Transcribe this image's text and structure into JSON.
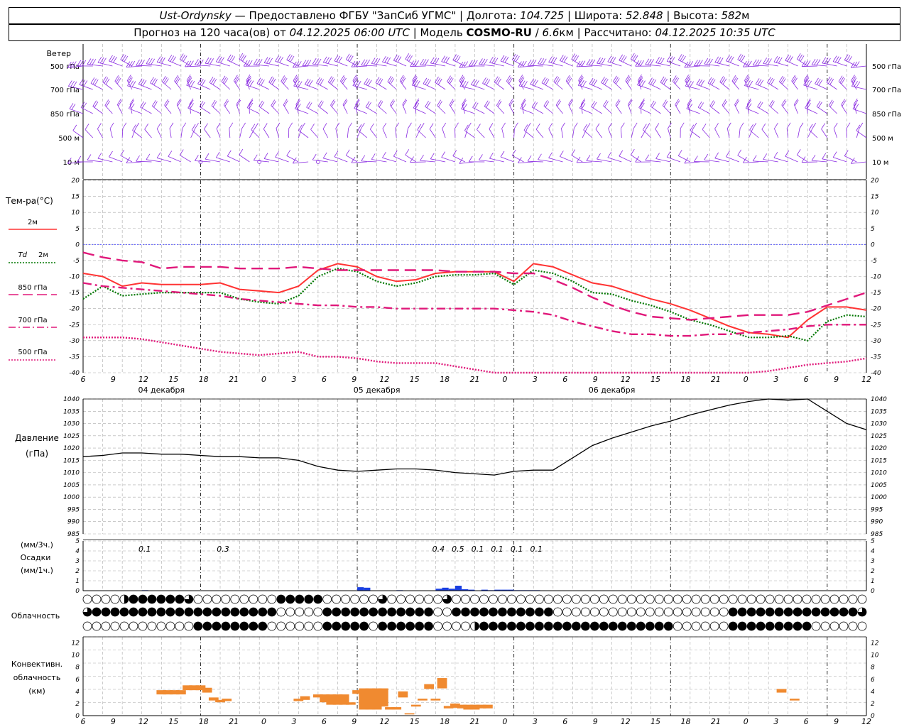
{
  "header": {
    "station": "Ust-Ordynsky",
    "line1_dash": " — ",
    "provider": "Предоставлено ФГБУ \"ЗапСиб УГМС\"",
    "lon_label": "Долгота:",
    "lon_value": "104.725",
    "lat_label": "Широта:",
    "lat_value": "52.848",
    "alt_label": "Высота:",
    "alt_value": "582",
    "alt_unit": "м",
    "forecast_prefix": "Прогноз на 120 часа(ов) от",
    "forecast_start": "04.12.2025 06:00 UTC",
    "model_label": "Модель",
    "model_name": "COSMO-RU",
    "model_res": "6.6",
    "model_res_unit": "км",
    "computed_label": "Рассчитано:",
    "computed_value": "04.12.2025 10:35 UTC"
  },
  "chart_data": [
    {
      "type": "wind_barbs",
      "title": "Ветер",
      "levels": [
        "500 гПа",
        "700 гПа",
        "850 гПа",
        "500 м",
        "10 м"
      ],
      "color": "#8a2be2"
    },
    {
      "type": "line",
      "title": "Тем-ра(°C)",
      "ylim": [
        -40,
        20
      ],
      "yticks": [
        20,
        15,
        10,
        5,
        0,
        -5,
        -10,
        -15,
        -20,
        -25,
        -30,
        -35,
        -40
      ],
      "x_hours": [
        0,
        3,
        6,
        9,
        12,
        15,
        18,
        21,
        24,
        27,
        30,
        33,
        36,
        39,
        42,
        45,
        48,
        51,
        54,
        57,
        60,
        63,
        66,
        69,
        72,
        75,
        78,
        81,
        84,
        87,
        90,
        93,
        96,
        99,
        102,
        105,
        108,
        111,
        114,
        117,
        120
      ],
      "series": [
        {
          "name": "2м",
          "color": "#ff3333",
          "style": "solid",
          "values": [
            -9,
            -10,
            -13,
            -12,
            -12.5,
            -12.5,
            -12.5,
            -12,
            -14,
            -14.5,
            -15,
            -13,
            -8,
            -6,
            -7,
            -10,
            -11.5,
            -11,
            -9,
            -8.5,
            -8.5,
            -8.5,
            -11.5,
            -6,
            -7,
            -9.5,
            -12,
            -13,
            -15,
            -17,
            -18.5,
            -20.5,
            -23,
            -25.5,
            -27.5,
            -28,
            -29,
            -23.5,
            -19.5,
            -19.5,
            -20.5
          ]
        },
        {
          "name": "Td 2м",
          "color": "#007700",
          "style": "dotted",
          "values": [
            -17,
            -13,
            -16,
            -15.5,
            -15,
            -15,
            -15,
            -15,
            -17,
            -18,
            -18.5,
            -16,
            -10,
            -7.5,
            -8.5,
            -11.5,
            -13,
            -12,
            -10,
            -9.5,
            -9.5,
            -9,
            -12.5,
            -8,
            -9,
            -11.5,
            -15,
            -15.5,
            -17.5,
            -19,
            -21,
            -23.5,
            -25,
            -27,
            -29,
            -29,
            -28.5,
            -30,
            -24,
            -22,
            -22.5
          ]
        },
        {
          "name": "850 гПа",
          "color": "#e0187a",
          "style": "dashed",
          "values": [
            -2.5,
            -4,
            -5,
            -5.5,
            -7.5,
            -7,
            -7,
            -7,
            -7.5,
            -7.5,
            -7.5,
            -7,
            -7.5,
            -8,
            -8,
            -8,
            -8,
            -8,
            -8,
            -8.5,
            -8.5,
            -8.5,
            -9,
            -9,
            -11,
            -13.5,
            -16.5,
            -19,
            -21,
            -22.5,
            -23,
            -23.5,
            -23,
            -22.5,
            -22,
            -22,
            -22,
            -21,
            -19,
            -17,
            -15
          ]
        },
        {
          "name": "700 гПа",
          "color": "#e0187a",
          "style": "dashdot",
          "values": [
            -12,
            -13,
            -13.5,
            -14,
            -14.5,
            -15,
            -15.5,
            -16,
            -17,
            -17.5,
            -18,
            -18.5,
            -19,
            -19,
            -19.5,
            -19.5,
            -20,
            -20,
            -20,
            -20,
            -20,
            -20,
            -20.5,
            -21,
            -22,
            -24,
            -25.5,
            -27,
            -28,
            -28,
            -28.5,
            -28.5,
            -28,
            -28,
            -27.5,
            -27,
            -26.5,
            -25.5,
            -25,
            -25,
            -25
          ]
        },
        {
          "name": "500 гПа",
          "color": "#e0187a",
          "style": "dotted",
          "values": [
            -29,
            -29,
            -29,
            -29.5,
            -30.5,
            -31.5,
            -32.5,
            -33.5,
            -34,
            -34.5,
            -34,
            -33.5,
            -35,
            -35,
            -35.5,
            -36.5,
            -37,
            -37,
            -37,
            -38,
            -39,
            -40.5,
            -42,
            -43,
            -43,
            -43,
            -43,
            -43,
            -43,
            -43,
            -43,
            -43,
            -42.5,
            -42,
            -41,
            -39.5,
            -38.5,
            -37.5,
            -37,
            -36.5,
            -35.5
          ]
        }
      ],
      "zero_line_color": "#4444ff"
    },
    {
      "type": "line",
      "title": "Давление",
      "unit": "(гПа)",
      "ylim": [
        985,
        1040
      ],
      "yticks": [
        1040,
        1035,
        1030,
        1025,
        1020,
        1015,
        1010,
        1005,
        1000,
        995,
        990,
        985
      ],
      "x_hours": [
        0,
        3,
        6,
        9,
        12,
        15,
        18,
        21,
        24,
        27,
        30,
        33,
        36,
        39,
        42,
        45,
        48,
        51,
        54,
        57,
        60,
        63,
        66,
        69,
        72,
        75,
        78,
        81,
        84,
        87,
        90,
        93,
        96,
        99,
        102,
        105,
        108,
        111,
        114,
        117,
        120
      ],
      "series": [
        {
          "name": "",
          "color": "#000000",
          "values": [
            1016.5,
            1017,
            1018,
            1018,
            1017.5,
            1017.5,
            1017,
            1016.5,
            1016.5,
            1016,
            1016,
            1015,
            1012.5,
            1011,
            1010.5,
            1011,
            1011.5,
            1011.5,
            1011,
            1010,
            1009.5,
            1009,
            1010.5,
            1011,
            1011,
            1016,
            1021,
            1024,
            1026.5,
            1029,
            1031,
            1033.5,
            1035.5,
            1037.5,
            1039,
            1040,
            1039.5,
            1040,
            1035,
            1030,
            1027.5
          ]
        }
      ]
    },
    {
      "type": "bar",
      "title": "Осадки",
      "unit_left": "(мм/3ч.)",
      "unit_left2": "(мм/1ч.)",
      "ylim": [
        0,
        5
      ],
      "yticks": [
        5,
        4,
        3,
        2,
        1,
        0
      ],
      "labels": [
        {
          "hour": 9,
          "text": "0.1"
        },
        {
          "hour": 21,
          "text": "0.3"
        },
        {
          "hour": 54,
          "text": "0.4"
        },
        {
          "hour": 57,
          "text": "0.5"
        },
        {
          "hour": 60,
          "text": "0.1"
        },
        {
          "hour": 63,
          "text": "0.1"
        },
        {
          "hour": 66,
          "text": "0.1"
        },
        {
          "hour": 69,
          "text": "0.1"
        }
      ],
      "bars": [
        {
          "hour": 9,
          "value": 0.05
        },
        {
          "hour": 42,
          "value": 0.35
        },
        {
          "hour": 43,
          "value": 0.3
        },
        {
          "hour": 48,
          "value": 0.05
        },
        {
          "hour": 54,
          "value": 0.2
        },
        {
          "hour": 55,
          "value": 0.3
        },
        {
          "hour": 56,
          "value": 0.2
        },
        {
          "hour": 57,
          "value": 0.5
        },
        {
          "hour": 58,
          "value": 0.15
        },
        {
          "hour": 59,
          "value": 0.1
        },
        {
          "hour": 61,
          "value": 0.1
        },
        {
          "hour": 62,
          "value": 0.05
        },
        {
          "hour": 63,
          "value": 0.1
        },
        {
          "hour": 64,
          "value": 0.1
        },
        {
          "hour": 65,
          "value": 0.1
        },
        {
          "hour": 66,
          "value": 0.05
        },
        {
          "hour": 67,
          "value": 0.05
        },
        {
          "hour": 68,
          "value": 0.05
        },
        {
          "hour": 69,
          "value": 0.05
        }
      ],
      "color": "#1a3fe0"
    },
    {
      "type": "cloud_symbols",
      "title": "Облачность",
      "rows": [
        "0000133333320000000003333300000020000002000000000000000000000000000000000000000000000000000000000000000000000000000000000",
        "2333333333333333333330000033333333333300333333333330000000000000000000333333333333332233333333333333",
        "0000000000003333333300000033333033333300001333333333333333333333000000333333333000000000000000000000"
      ]
    },
    {
      "type": "bar",
      "title": "Конвективн. облачность",
      "unit": "(км)",
      "ylim": [
        0,
        13
      ],
      "yticks": [
        12,
        10,
        8,
        6,
        4,
        2,
        0
      ],
      "color": "#f08a30",
      "bars": [
        {
          "hour": 12,
          "base": 3.5,
          "top": 4.2
        },
        {
          "hour": 13,
          "base": 3.5,
          "top": 4.2
        },
        {
          "hour": 14,
          "base": 3.5,
          "top": 4.2
        },
        {
          "hour": 15,
          "base": 3.5,
          "top": 4.2
        },
        {
          "hour": 16,
          "base": 4.2,
          "top": 5.0
        },
        {
          "hour": 17,
          "base": 4.2,
          "top": 5.0
        },
        {
          "hour": 18,
          "base": 4.2,
          "top": 5.0
        },
        {
          "hour": 19,
          "base": 3.8,
          "top": 4.6
        },
        {
          "hour": 20,
          "base": 2.5,
          "top": 3.0
        },
        {
          "hour": 21,
          "base": 2.2,
          "top": 2.6
        },
        {
          "hour": 22,
          "base": 2.4,
          "top": 2.8
        },
        {
          "hour": 33,
          "base": 2.4,
          "top": 2.8
        },
        {
          "hour": 34,
          "base": 2.6,
          "top": 3.2
        },
        {
          "hour": 36,
          "base": 3.0,
          "top": 3.5
        },
        {
          "hour": 37,
          "base": 2.2,
          "top": 3.5
        },
        {
          "hour": 38,
          "base": 1.8,
          "top": 3.5
        },
        {
          "hour": 39,
          "base": 1.8,
          "top": 3.5
        },
        {
          "hour": 40,
          "base": 1.8,
          "top": 3.5
        },
        {
          "hour": 41,
          "base": 1.8,
          "top": 2.2
        },
        {
          "hour": 42,
          "base": 3.6,
          "top": 4.2
        },
        {
          "hour": 43,
          "base": 1.0,
          "top": 4.5
        },
        {
          "hour": 44,
          "base": 1.0,
          "top": 4.5
        },
        {
          "hour": 45,
          "base": 1.0,
          "top": 4.5
        },
        {
          "hour": 46,
          "base": 1.5,
          "top": 4.5
        },
        {
          "hour": 47,
          "base": 1.0,
          "top": 1.4
        },
        {
          "hour": 48,
          "base": 1.0,
          "top": 1.4
        },
        {
          "hour": 49,
          "base": 3.0,
          "top": 4.0
        },
        {
          "hour": 50,
          "base": 0.2,
          "top": 0.4
        },
        {
          "hour": 51,
          "base": 1.5,
          "top": 1.8
        },
        {
          "hour": 52,
          "base": 2.5,
          "top": 2.8
        },
        {
          "hour": 53,
          "base": 4.4,
          "top": 5.2
        },
        {
          "hour": 54,
          "base": 2.5,
          "top": 2.8
        },
        {
          "hour": 55,
          "base": 4.5,
          "top": 6.2
        },
        {
          "hour": 56,
          "base": 1.2,
          "top": 1.6
        },
        {
          "hour": 57,
          "base": 1.3,
          "top": 2.0
        },
        {
          "hour": 58,
          "base": 1.2,
          "top": 1.8
        },
        {
          "hour": 59,
          "base": 1.0,
          "top": 1.8
        },
        {
          "hour": 60,
          "base": 1.0,
          "top": 1.8
        },
        {
          "hour": 61,
          "base": 1.2,
          "top": 1.8
        },
        {
          "hour": 62,
          "base": 1.2,
          "top": 1.8
        },
        {
          "hour": 107,
          "base": 3.8,
          "top": 4.4
        },
        {
          "hour": 109,
          "base": 2.5,
          "top": 2.8
        }
      ]
    }
  ],
  "x_axis": {
    "hour_labels": [
      "6",
      "9",
      "12",
      "15",
      "18",
      "21",
      "0",
      "3",
      "6",
      "9",
      "12",
      "15",
      "18",
      "21",
      "0",
      "3",
      "6",
      "9",
      "12",
      "15",
      "18",
      "21",
      "0",
      "3",
      "6",
      "9",
      "12"
    ],
    "day_labels": [
      "04 декабря",
      "05 декабря",
      "06 декабря"
    ]
  },
  "legend": {
    "t2m": "2м",
    "td_prefix": "Td",
    "td_suffix": "2м",
    "t850": "850 гПа",
    "t700": "700 гПа",
    "t500": "500 гПа"
  }
}
